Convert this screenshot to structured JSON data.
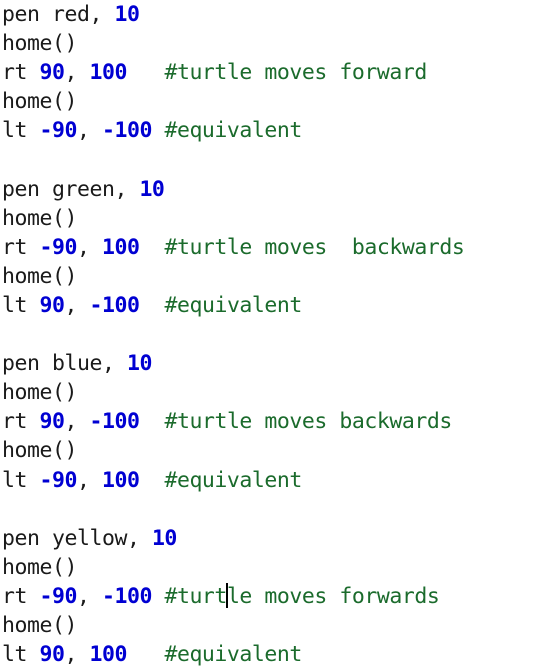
{
  "editor": {
    "name": "code-editor-pane",
    "background_color": "#ffffff",
    "colors": {
      "text": "#1a1a1a",
      "number": "#0000d2",
      "comment": "#1b6b2c",
      "caret": "#000000"
    },
    "caret": {
      "line_index": 22,
      "after_text": "rt -90, -100 #turt",
      "visible": true
    },
    "lines": [
      {
        "index": 0,
        "text": "pen red, 10",
        "tokens": [
          {
            "t": "pen red, ",
            "k": "plain"
          },
          {
            "t": "10",
            "k": "num"
          }
        ]
      },
      {
        "index": 1,
        "text": "home()",
        "tokens": [
          {
            "t": "home()",
            "k": "plain"
          }
        ]
      },
      {
        "index": 2,
        "text": "rt 90, 100   #turtle moves forward",
        "tokens": [
          {
            "t": "rt ",
            "k": "plain"
          },
          {
            "t": "90",
            "k": "num"
          },
          {
            "t": ", ",
            "k": "plain"
          },
          {
            "t": "100",
            "k": "num"
          },
          {
            "t": "   ",
            "k": "plain"
          },
          {
            "t": "#turtle moves forward",
            "k": "cmt"
          }
        ]
      },
      {
        "index": 3,
        "text": "home()",
        "tokens": [
          {
            "t": "home()",
            "k": "plain"
          }
        ]
      },
      {
        "index": 4,
        "text": "lt -90, -100 #equivalent",
        "tokens": [
          {
            "t": "lt ",
            "k": "plain"
          },
          {
            "t": "-90",
            "k": "num"
          },
          {
            "t": ", ",
            "k": "plain"
          },
          {
            "t": "-100",
            "k": "num"
          },
          {
            "t": " ",
            "k": "plain"
          },
          {
            "t": "#equivalent",
            "k": "cmt"
          }
        ]
      },
      {
        "index": 5,
        "text": "",
        "tokens": []
      },
      {
        "index": 6,
        "text": "pen green, 10",
        "tokens": [
          {
            "t": "pen green, ",
            "k": "plain"
          },
          {
            "t": "10",
            "k": "num"
          }
        ]
      },
      {
        "index": 7,
        "text": "home()",
        "tokens": [
          {
            "t": "home()",
            "k": "plain"
          }
        ]
      },
      {
        "index": 8,
        "text": "rt -90, 100  #turtle moves  backwards",
        "tokens": [
          {
            "t": "rt ",
            "k": "plain"
          },
          {
            "t": "-90",
            "k": "num"
          },
          {
            "t": ", ",
            "k": "plain"
          },
          {
            "t": "100",
            "k": "num"
          },
          {
            "t": "  ",
            "k": "plain"
          },
          {
            "t": "#turtle moves  backwards",
            "k": "cmt"
          }
        ]
      },
      {
        "index": 9,
        "text": "home()",
        "tokens": [
          {
            "t": "home()",
            "k": "plain"
          }
        ]
      },
      {
        "index": 10,
        "text": "lt 90, -100  #equivalent",
        "tokens": [
          {
            "t": "lt ",
            "k": "plain"
          },
          {
            "t": "90",
            "k": "num"
          },
          {
            "t": ", ",
            "k": "plain"
          },
          {
            "t": "-100",
            "k": "num"
          },
          {
            "t": "  ",
            "k": "plain"
          },
          {
            "t": "#equivalent",
            "k": "cmt"
          }
        ]
      },
      {
        "index": 11,
        "text": "",
        "tokens": []
      },
      {
        "index": 12,
        "text": "pen blue, 10",
        "tokens": [
          {
            "t": "pen blue, ",
            "k": "plain"
          },
          {
            "t": "10",
            "k": "num"
          }
        ]
      },
      {
        "index": 13,
        "text": "home()",
        "tokens": [
          {
            "t": "home()",
            "k": "plain"
          }
        ]
      },
      {
        "index": 14,
        "text": "rt 90, -100  #turtle moves backwards",
        "tokens": [
          {
            "t": "rt ",
            "k": "plain"
          },
          {
            "t": "90",
            "k": "num"
          },
          {
            "t": ", ",
            "k": "plain"
          },
          {
            "t": "-100",
            "k": "num"
          },
          {
            "t": "  ",
            "k": "plain"
          },
          {
            "t": "#turtle moves backwards",
            "k": "cmt"
          }
        ]
      },
      {
        "index": 15,
        "text": "home()",
        "tokens": [
          {
            "t": "home()",
            "k": "plain"
          }
        ]
      },
      {
        "index": 16,
        "text": "lt -90, 100  #equivalent",
        "tokens": [
          {
            "t": "lt ",
            "k": "plain"
          },
          {
            "t": "-90",
            "k": "num"
          },
          {
            "t": ", ",
            "k": "plain"
          },
          {
            "t": "100",
            "k": "num"
          },
          {
            "t": "  ",
            "k": "plain"
          },
          {
            "t": "#equivalent",
            "k": "cmt"
          }
        ]
      },
      {
        "index": 17,
        "text": "",
        "tokens": []
      },
      {
        "index": 18,
        "text": "pen yellow, 10",
        "tokens": [
          {
            "t": "pen yellow, ",
            "k": "plain"
          },
          {
            "t": "10",
            "k": "num"
          }
        ]
      },
      {
        "index": 19,
        "text": "home()",
        "tokens": [
          {
            "t": "home()",
            "k": "plain"
          }
        ]
      },
      {
        "index": 20,
        "text": "rt -90, -100 #turtle moves forwards",
        "tokens": [
          {
            "t": "rt ",
            "k": "plain"
          },
          {
            "t": "-90",
            "k": "num"
          },
          {
            "t": ", ",
            "k": "plain"
          },
          {
            "t": "-100",
            "k": "num"
          },
          {
            "t": " ",
            "k": "plain"
          },
          {
            "t": "#turt",
            "k": "cmt"
          },
          {
            "t": "",
            "k": "caret"
          },
          {
            "t": "le moves forwards",
            "k": "cmt"
          }
        ]
      },
      {
        "index": 21,
        "text": "home()",
        "tokens": [
          {
            "t": "home()",
            "k": "plain"
          }
        ]
      },
      {
        "index": 22,
        "text": "lt 90, 100   #equivalent",
        "tokens": [
          {
            "t": "lt ",
            "k": "plain"
          },
          {
            "t": "90",
            "k": "num"
          },
          {
            "t": ", ",
            "k": "plain"
          },
          {
            "t": "100",
            "k": "num"
          },
          {
            "t": "   ",
            "k": "plain"
          },
          {
            "t": "#equivalent",
            "k": "cmt"
          }
        ]
      }
    ]
  }
}
